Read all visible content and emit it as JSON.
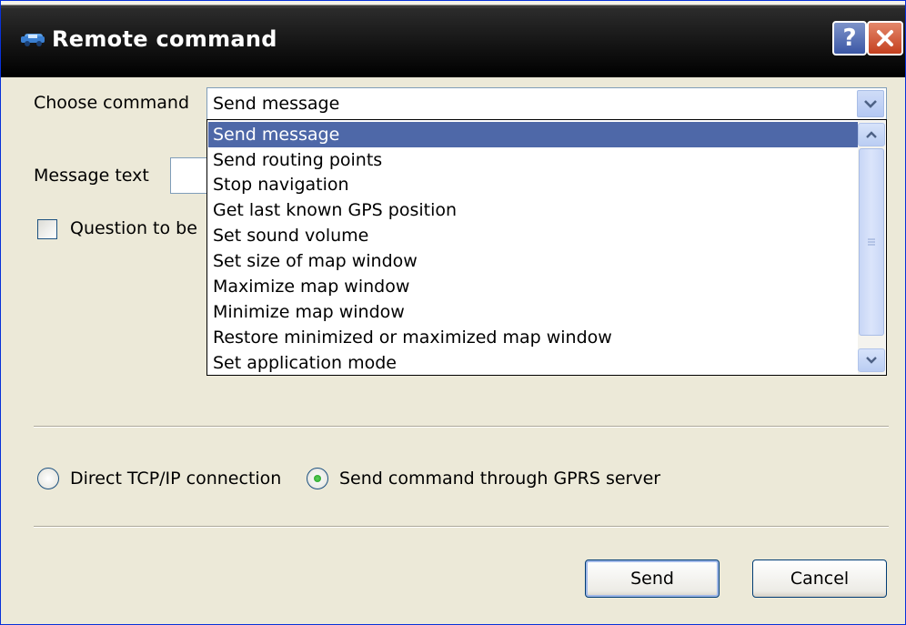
{
  "window": {
    "title": "Remote command",
    "help_label": "?",
    "title_icon": "remote-car-icon"
  },
  "form": {
    "choose_command_label": "Choose command",
    "selected_command": "Send message",
    "message_text_label": "Message text",
    "question_label": "Question to be",
    "question_checked": false
  },
  "dropdown": {
    "options": [
      "Send message",
      "Send routing points",
      "Stop navigation",
      "Get last known GPS position",
      "Set sound volume",
      "Set size of map window",
      "Maximize map window",
      "Minimize map window",
      "Restore minimized or maximized map window",
      "Set application mode"
    ],
    "highlighted_index": 0
  },
  "connection": {
    "direct_label": "Direct TCP/IP connection",
    "gprs_label": "Send command through GPRS server",
    "selected": "gprs"
  },
  "buttons": {
    "send_label": "Send",
    "cancel_label": "Cancel"
  },
  "colors": {
    "selection": "#4e68a8",
    "titlebar": "#1c1c1c",
    "close": "#c4401f"
  }
}
